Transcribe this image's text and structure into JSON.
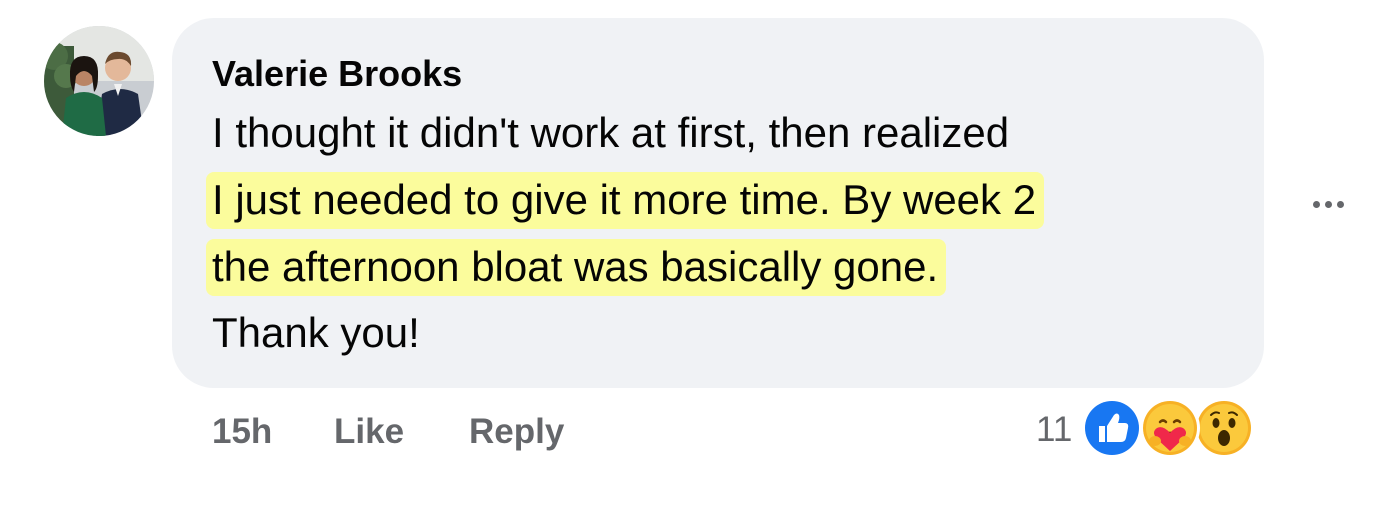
{
  "comment": {
    "author": "Valerie Brooks",
    "lines": [
      "I thought it didn't work at first, then realized",
      "I just needed to give it more time. By week 2",
      "the afternoon bloat was basically gone.",
      "Thank you!"
    ],
    "highlighted_lines": [
      1,
      2
    ],
    "highlight_color": "#fbfc9c",
    "bubble_color": "#f0f2f5"
  },
  "actions": {
    "time": "15h",
    "like_label": "Like",
    "reply_label": "Reply"
  },
  "reactions": {
    "count": "11",
    "icons": [
      "like-icon",
      "care-icon",
      "wow-icon"
    ],
    "like_color": "#1877f2"
  },
  "more_icon": "ellipsis-icon"
}
